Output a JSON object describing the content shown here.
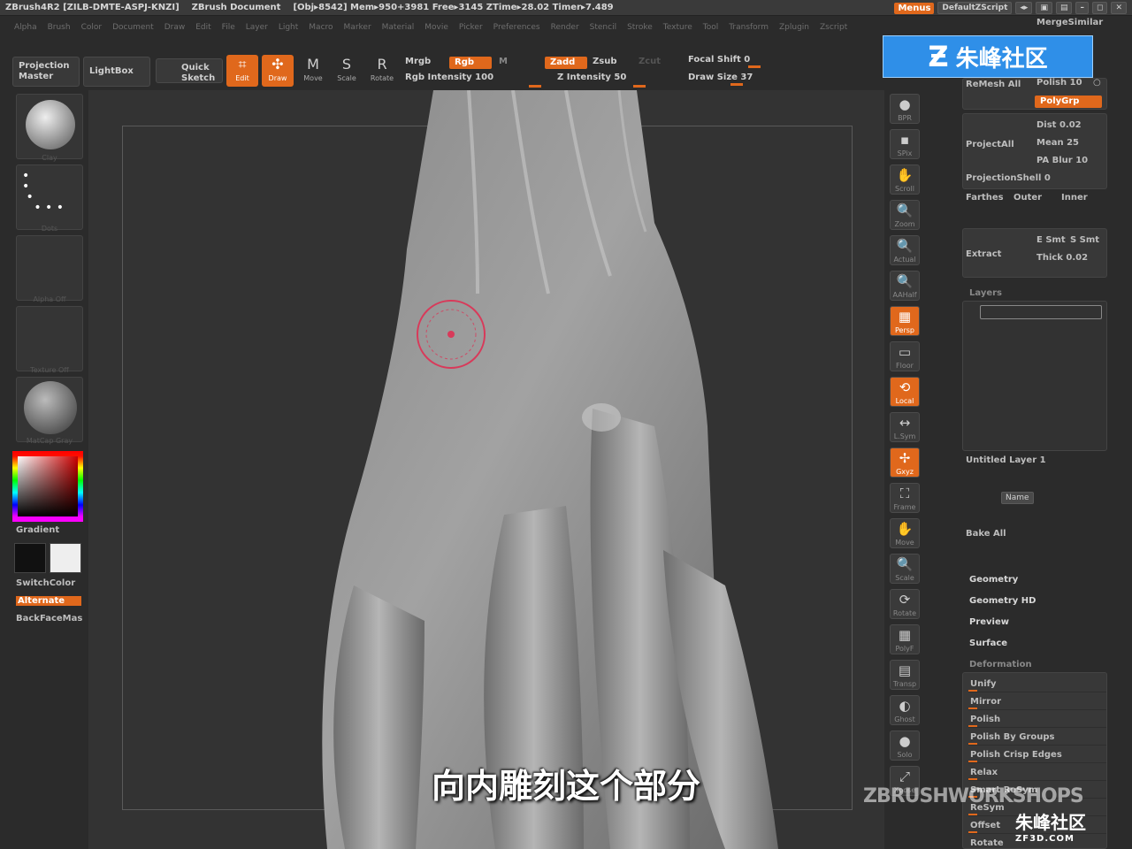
{
  "titlebar": {
    "app": "ZBrush4R2 [ZILB-DMTE-ASPJ-KNZI]",
    "document": "ZBrush Document",
    "obj": "[Obj▸8542] Mem▸950+3981 Free▸3145 ZTime▸28.02 Timer▸7.489",
    "menus_btn": "Menus",
    "script": "DefaultZScript"
  },
  "menubar": [
    "Alpha",
    "Brush",
    "Color",
    "Document",
    "Draw",
    "Edit",
    "File",
    "Layer",
    "Light",
    "Macro",
    "Marker",
    "Material",
    "Movie",
    "Picker",
    "Preferences",
    "Render",
    "Stencil",
    "Stroke",
    "Texture",
    "Tool",
    "Transform",
    "Zplugin",
    "Zscript"
  ],
  "toolbar": {
    "projection_master": "Projection Master",
    "lightbox": "LightBox",
    "quick_sketch": "Quick Sketch",
    "edit": "Edit",
    "draw": "Draw",
    "move": "Move",
    "scale": "Scale",
    "rotate": "Rotate",
    "mrgb": "Mrgb",
    "rgb": "Rgb",
    "m": "M",
    "rgb_intensity": "Rgb Intensity 100",
    "zadd": "Zadd",
    "zsub": "Zsub",
    "zcut": "Zcut",
    "z_intensity": "Z Intensity 50",
    "focal_shift": "Focal Shift 0",
    "draw_size": "Draw Size 37"
  },
  "left_shelf": {
    "clay_label": "Clay",
    "dots_label": "Dots",
    "alpha_label": "Alpha Off",
    "texture_label": "Texture Off",
    "matcap_label": "MatCap Gray",
    "gradient": "Gradient",
    "switch_color": "SwitchColor",
    "alternate": "Alternate",
    "backface": "BackFaceMas"
  },
  "right_shelf": [
    "BPR",
    "SPix",
    "Scroll",
    "Zoom",
    "Actual",
    "AAHalf",
    "Persp",
    "Floor",
    "Local",
    "L.Sym",
    "Gxyz",
    "Frame",
    "Move",
    "Scale",
    "Rotate",
    "PolyF",
    "Transp",
    "Ghost",
    "Solo",
    "Xpose"
  ],
  "right_panel": {
    "merge_similar": "MergeSimilar",
    "remesh_all": "ReMesh All",
    "polish": "Polish 10",
    "polygrp": "PolyGrp",
    "project_all": "ProjectAll",
    "dist": "Dist 0.02",
    "mean": "Mean 25",
    "pa_blur": "PA Blur 10",
    "projection_shell": "ProjectionShell 0",
    "farthest": "Farthes",
    "outer": "Outer",
    "inner": "Inner",
    "extract": "Extract",
    "e_smt": "E Smt",
    "s_smt": "S Smt",
    "thick": "Thick 0.02",
    "layers": "Layers",
    "untitled_layer": "Untitled Layer 1",
    "name_btn": "Name",
    "bake_all": "Bake All",
    "geometry": "Geometry",
    "geometry_hd": "Geometry HD",
    "preview": "Preview",
    "surface": "Surface",
    "deformation": "Deformation",
    "deform_items": [
      "Unify",
      "Mirror",
      "Polish",
      "Polish By Groups",
      "Polish Crisp Edges",
      "Relax",
      "Smart ReSym",
      "ReSym",
      "Offset",
      "Rotate"
    ]
  },
  "watermark": {
    "logo": "朱峰社区",
    "zbrush_ws": "ZBRUSHWORKSHOPS",
    "zf": "朱峰社区",
    "zf_url": "ZF3D.COM"
  },
  "subtitle": "向内雕刻这个部分",
  "colors": {
    "accent": "#e0681c",
    "bg": "#2b2b2b",
    "logo_blue": "#2f8fe8"
  }
}
